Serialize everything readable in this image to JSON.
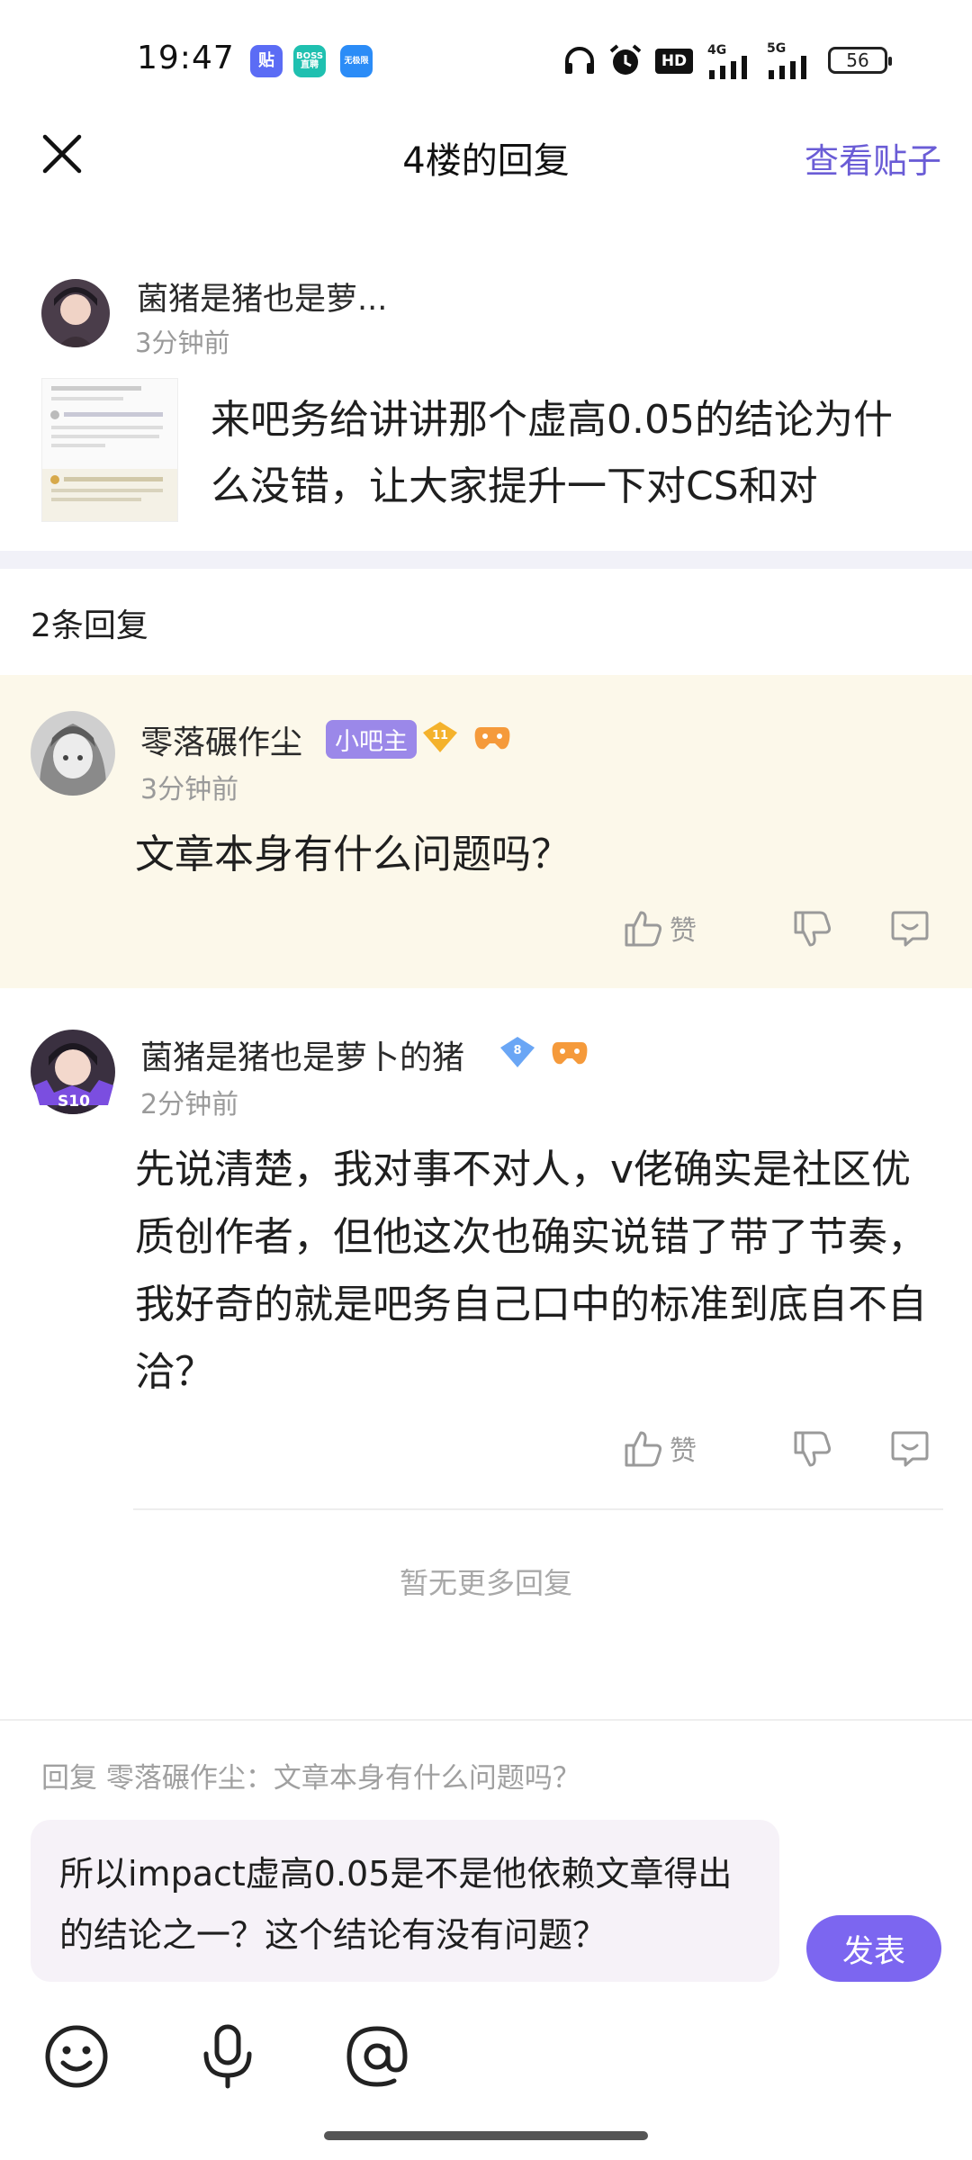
{
  "status_bar": {
    "time": "19:47",
    "apps": [
      {
        "label": "贴",
        "color": "#5b6cf5"
      },
      {
        "label": "BOSS\n直聘",
        "color": "#1fc0b0"
      },
      {
        "label": "无极限",
        "color": "#2b8cf7"
      }
    ],
    "battery": "56",
    "net1": "4G",
    "net2": "5G",
    "hd": "HD"
  },
  "header": {
    "title": "4楼的回复",
    "view_post": "查看贴子"
  },
  "original_post": {
    "author": "菌猪是猪也是萝...",
    "time": "3分钟前",
    "text": "来吧务给讲讲那个虚高0.05的结论为什么没错，让大家提升一下对CS和对"
  },
  "replies_count": "2条回复",
  "replies": [
    {
      "author": "零落碾作尘",
      "owner_badge": "小吧主",
      "level": "11",
      "time": "3分钟前",
      "text": "文章本身有什么问题吗？",
      "like_label": "赞"
    },
    {
      "author": "菌猪是猪也是萝卜的猪",
      "level": "8",
      "season_badge": "S10",
      "time": "2分钟前",
      "text": "先说清楚，我对事不对人，v佬确实是社区优质创作者，但他这次也确实说错了带了节奏，我好奇的就是吧务自己口中的标准到底自不自洽？",
      "like_label": "赞"
    }
  ],
  "no_more": "暂无更多回复",
  "composer": {
    "reply_hint": "回复 零落碾作尘：文章本身有什么问题吗？",
    "draft": "所以impact虚高0.05是不是他依赖文章得出的结论之一？这个结论有没有问题？",
    "publish": "发表"
  },
  "colors": {
    "accent": "#7c66f0",
    "link": "#6a5cd6",
    "highlight_row": "#fcf8ea"
  }
}
